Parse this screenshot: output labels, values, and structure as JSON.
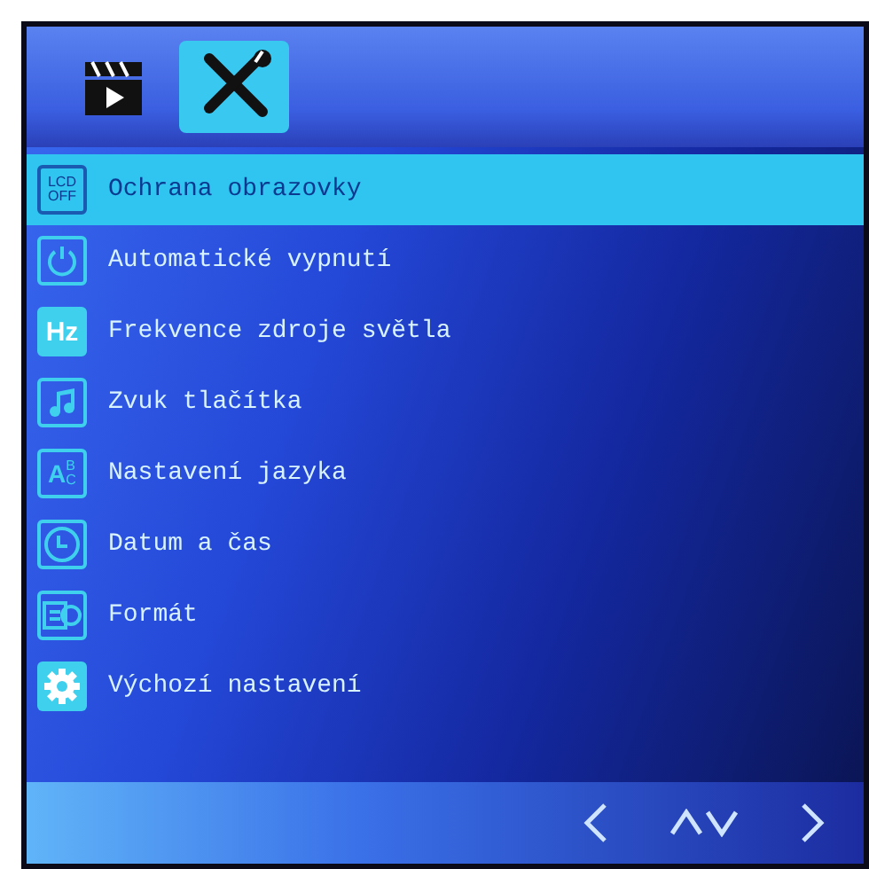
{
  "tabs": [
    {
      "kind": "video",
      "selected": false
    },
    {
      "kind": "tools",
      "selected": true
    }
  ],
  "menu": [
    {
      "kind": "lcd-off",
      "icon_text": [
        "LCD",
        "OFF"
      ],
      "label": "Ochrana obrazovky",
      "selected": true
    },
    {
      "kind": "power",
      "label": "Automatické vypnutí",
      "selected": false
    },
    {
      "kind": "hz",
      "icon_text": [
        "Hz"
      ],
      "label": "Frekvence zdroje světla",
      "selected": false
    },
    {
      "kind": "music",
      "label": "Zvuk tlačítka",
      "selected": false
    },
    {
      "kind": "language",
      "icon_text": [
        "A",
        "B",
        "C"
      ],
      "label": "Nastavení jazyka",
      "selected": false
    },
    {
      "kind": "clock",
      "label": "Datum a čas",
      "selected": false
    },
    {
      "kind": "format",
      "label": "Formát",
      "selected": false
    },
    {
      "kind": "gear",
      "label": "Výchozí nastavení",
      "selected": false
    }
  ]
}
